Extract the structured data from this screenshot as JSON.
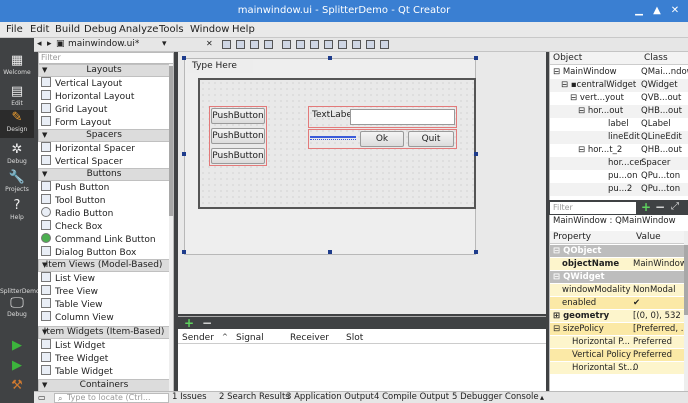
{
  "window": {
    "title": "mainwindow.ui - SplitterDemo - Qt Creator"
  },
  "menu": [
    "File",
    "Edit",
    "Build",
    "Debug",
    "Analyze",
    "Tools",
    "Window",
    "Help"
  ],
  "modes": [
    {
      "label": "Welcome",
      "icon": "grid-icon"
    },
    {
      "label": "Edit",
      "icon": "document-icon"
    },
    {
      "label": "Design",
      "icon": "pencil-icon"
    },
    {
      "label": "Debug",
      "icon": "bug-icon"
    },
    {
      "label": "Projects",
      "icon": "wrench-icon"
    },
    {
      "label": "Help",
      "icon": "help-icon"
    }
  ],
  "target": {
    "project": "SplitterDemo",
    "config": "Debug"
  },
  "editor": {
    "file": "mainwindow.ui*"
  },
  "widgetbox": {
    "filter_placeholder": "Filter",
    "categories": [
      {
        "name": "Layouts",
        "items": [
          "Vertical Layout",
          "Horizontal Layout",
          "Grid Layout",
          "Form Layout"
        ]
      },
      {
        "name": "Spacers",
        "items": [
          "Horizontal Spacer",
          "Vertical Spacer"
        ]
      },
      {
        "name": "Buttons",
        "items": [
          "Push Button",
          "Tool Button",
          "Radio Button",
          "Check Box",
          "Command Link Button",
          "Dialog Button Box"
        ]
      },
      {
        "name": "Item Views (Model-Based)",
        "items": [
          "List View",
          "Tree View",
          "Table View",
          "Column View"
        ]
      },
      {
        "name": "Item Widgets (Item-Based)",
        "items": [
          "List Widget",
          "Tree Widget",
          "Table Widget"
        ]
      },
      {
        "name": "Containers",
        "items": []
      }
    ]
  },
  "form": {
    "menu_placeholder": "Type Here",
    "push_buttons": [
      "PushButton",
      "PushButton",
      "PushButton"
    ],
    "text_label": "TextLabel",
    "ok": "Ok",
    "quit": "Quit"
  },
  "signals": {
    "columns": [
      "Sender",
      "Signal",
      "Receiver",
      "Slot"
    ]
  },
  "object_inspector": {
    "columns": [
      "Object",
      "Class"
    ],
    "rows": [
      {
        "name": "MainWindow",
        "cls": "QMai...ndow"
      },
      {
        "name": "centralWidget",
        "cls": "QWidget"
      },
      {
        "name": "vert...yout",
        "cls": "QVB...out"
      },
      {
        "name": "hor...out",
        "cls": "QHB...out"
      },
      {
        "name": "label",
        "cls": "QLabel"
      },
      {
        "name": "lineEdit",
        "cls": "QLineEdit"
      },
      {
        "name": "hor...t_2",
        "cls": "QHB...out"
      },
      {
        "name": "hor...cer",
        "cls": "Spacer"
      },
      {
        "name": "pu...on",
        "cls": "QPu...ton"
      },
      {
        "name": "pu...2",
        "cls": "QPu...ton"
      }
    ]
  },
  "property_editor": {
    "filter_placeholder": "Filter",
    "context": "MainWindow : QMainWindow",
    "columns": [
      "Property",
      "Value"
    ],
    "rows": [
      {
        "p": "QObject",
        "v": ""
      },
      {
        "p": "objectName",
        "v": "MainWindow"
      },
      {
        "p": "QWidget",
        "v": ""
      },
      {
        "p": "windowModality",
        "v": "NonModal"
      },
      {
        "p": "enabled",
        "v": "✔"
      },
      {
        "p": "geometry",
        "v": "[(0, 0), 532 ..."
      },
      {
        "p": "sizePolicy",
        "v": "[Preferred, ..."
      },
      {
        "p": "Horizontal P...",
        "v": "Preferred"
      },
      {
        "p": "Vertical Policy",
        "v": "Preferred"
      },
      {
        "p": "Horizontal St...",
        "v": "0"
      }
    ]
  },
  "statusbar": {
    "locate_placeholder": "Type to locate (Ctrl...",
    "tabs": [
      "1 Issues",
      "2 Search Results",
      "3 Application Output",
      "4 Compile Output",
      "5 Debugger Console"
    ]
  }
}
